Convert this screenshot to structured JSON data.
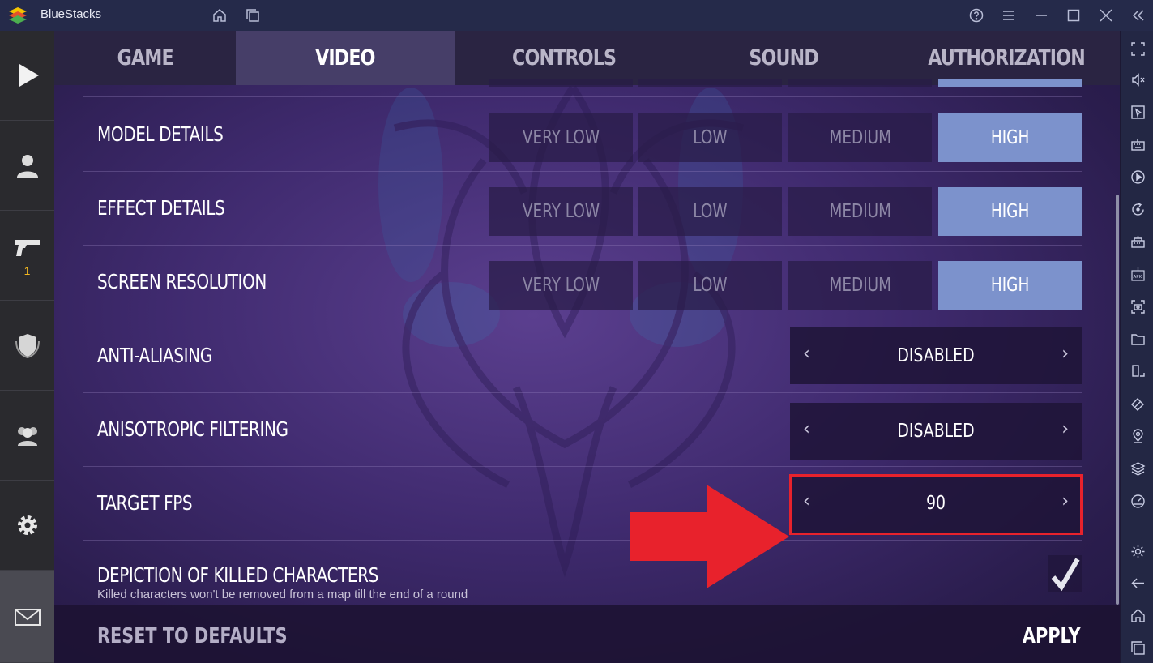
{
  "app": {
    "title": "BlueStacks"
  },
  "tabs": [
    {
      "label": "GAME",
      "active": false
    },
    {
      "label": "VIDEO",
      "active": true
    },
    {
      "label": "CONTROLS",
      "active": false
    },
    {
      "label": "SOUND",
      "active": false
    },
    {
      "label": "AUTHORIZATION",
      "active": false
    }
  ],
  "quality_options": [
    "VERY LOW",
    "LOW",
    "MEDIUM",
    "HIGH"
  ],
  "settings": {
    "model_details": {
      "label": "MODEL DETAILS",
      "selected": "HIGH"
    },
    "effect_details": {
      "label": "EFFECT DETAILS",
      "selected": "HIGH"
    },
    "screen_resolution": {
      "label": "SCREEN RESOLUTION",
      "selected": "HIGH"
    },
    "anti_aliasing": {
      "label": "ANTI-ALIASING",
      "value": "DISABLED"
    },
    "anisotropic_filtering": {
      "label": "ANISOTROPIC FILTERING",
      "value": "DISABLED"
    },
    "target_fps": {
      "label": "TARGET FPS",
      "value": "90"
    },
    "depiction": {
      "label": "DEPICTION OF KILLED CHARACTERS",
      "subtitle": "Killed characters won't be removed from a map till the end of a round",
      "checked": true
    }
  },
  "stepper_arrows": {
    "left": "‹",
    "right": "›"
  },
  "sidebar": {
    "weapons_count": "1"
  },
  "footer": {
    "reset_label": "RESET TO DEFAULTS",
    "apply_label": "APPLY"
  },
  "colors": {
    "selected": "#7c92cc",
    "highlight": "#e8222c",
    "accent_yellow": "#f3b820"
  },
  "titlebar_icons": [
    "home-icon",
    "multi-instance-icon",
    "help-icon",
    "menu-icon",
    "minimize-icon",
    "maximize-icon",
    "close-icon",
    "collapse-sidebar-icon"
  ],
  "right_toolbar_icons": [
    "fullscreen-icon",
    "volume-icon",
    "pointer-icon",
    "keyboard-icon",
    "media-icon",
    "rotate-icon",
    "macro-icon",
    "apk-icon",
    "screenshot-icon",
    "folder-icon",
    "resize-icon",
    "eraser-icon",
    "location-icon",
    "layers-icon",
    "speedometer-icon",
    "settings-icon",
    "back-icon",
    "home-icon",
    "recent-apps-icon"
  ]
}
